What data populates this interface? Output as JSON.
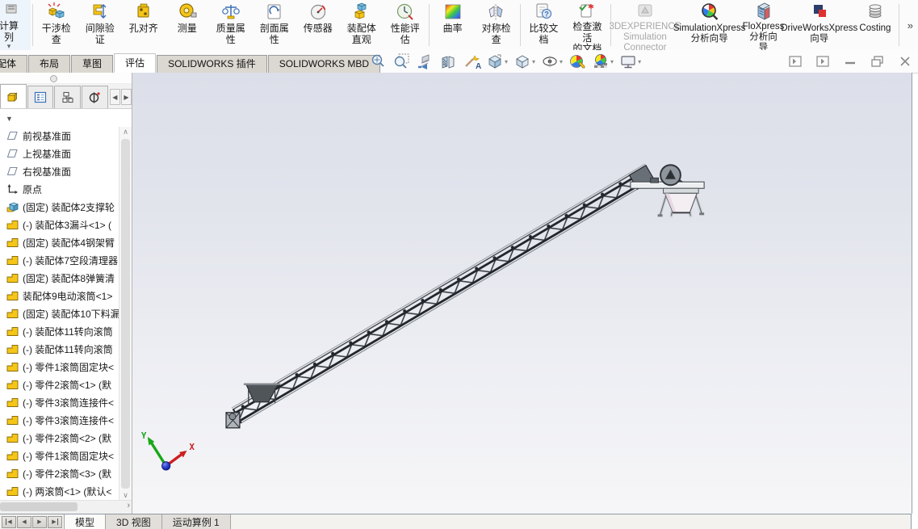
{
  "glyphs": {
    "caret": "▾",
    "overflow": "»",
    "panel_caret": "▼",
    "scroll_up": "∧",
    "scroll_down": "∨",
    "scroll_right": "›",
    "nav_prev": "◀",
    "nav_next": "▶",
    "ptab_left": "◀",
    "ptab_right": "▶"
  },
  "command_bar": {
    "items": [
      {
        "name": "calculate",
        "label": "计算\n列"
      },
      {
        "name": "interference-detection",
        "label": "干涉检\n查"
      },
      {
        "name": "clearance-verification",
        "label": "间隙验\n证"
      },
      {
        "name": "hole-alignment",
        "label": "孔对齐"
      },
      {
        "name": "measure",
        "label": "测量"
      },
      {
        "name": "mass-properties",
        "label": "质量属\n性"
      },
      {
        "name": "section-properties",
        "label": "剖面属\n性"
      },
      {
        "name": "sensor",
        "label": "传感器"
      },
      {
        "name": "assembly-visualization",
        "label": "装配体\n直观"
      },
      {
        "name": "performance-evaluation",
        "label": "性能评\n估"
      },
      {
        "name": "curvature",
        "label": "曲率"
      },
      {
        "name": "symmetry-check",
        "label": "对称检\n查"
      },
      {
        "name": "compare-documents",
        "label": "比较文\n档"
      },
      {
        "name": "check-active-document",
        "label": "检查激活\n的文档"
      },
      {
        "name": "3dexperience-simulation-connector",
        "label": "3DEXPERIENCE\nSimulation\nConnector"
      },
      {
        "name": "simulationxpress-wizard",
        "label": "SimulationXpress\n分析向导"
      },
      {
        "name": "floxpress-wizard",
        "label": "FloXpress\n分析向\n导"
      },
      {
        "name": "driveworksxpress-wizard",
        "label": "DriveWorksXpress\n向导"
      },
      {
        "name": "costing",
        "label": "Costing"
      }
    ]
  },
  "command_tabs": {
    "items": [
      {
        "label": "装配体"
      },
      {
        "label": "布局"
      },
      {
        "label": "草图"
      },
      {
        "label": "评估",
        "active": true
      },
      {
        "label": "SOLIDWORKS 插件"
      },
      {
        "label": "SOLIDWORKS MBD"
      }
    ]
  },
  "feature_tree": {
    "items": [
      {
        "type": "plane",
        "label": "前视基准面"
      },
      {
        "type": "plane",
        "label": "上视基准面"
      },
      {
        "type": "plane",
        "label": "右视基准面"
      },
      {
        "type": "origin",
        "label": "原点"
      },
      {
        "type": "part",
        "label": "(固定) 装配体2支撑轮"
      },
      {
        "type": "asm",
        "label": "(-) 装配体3漏斗<1> ("
      },
      {
        "type": "asm",
        "label": "(固定) 装配体4钢架臂"
      },
      {
        "type": "asm",
        "label": "(-) 装配体7空段清理器"
      },
      {
        "type": "asm",
        "label": "(固定) 装配体8弹簧清"
      },
      {
        "type": "asm",
        "label": "装配体9电动滚筒<1>"
      },
      {
        "type": "asm",
        "label": "(固定) 装配体10下料漏"
      },
      {
        "type": "asm",
        "label": "(-) 装配体11转向滚筒"
      },
      {
        "type": "asm",
        "label": "(-) 装配体11转向滚筒"
      },
      {
        "type": "asm",
        "label": "(-) 零件1滚筒固定块<"
      },
      {
        "type": "asm",
        "label": "(-) 零件2滚筒<1> (默"
      },
      {
        "type": "asm",
        "label": "(-) 零件3滚筒连接件<"
      },
      {
        "type": "asm",
        "label": "(-) 零件3滚筒连接件<"
      },
      {
        "type": "asm",
        "label": "(-) 零件2滚筒<2> (默"
      },
      {
        "type": "asm",
        "label": "(-) 零件1滚筒固定块<"
      },
      {
        "type": "asm",
        "label": "(-) 零件2滚筒<3> (默"
      },
      {
        "type": "asm",
        "label": "(-) 两滚筒<1> (默认<"
      }
    ]
  },
  "viewport": {
    "triad": {
      "x_label": "X",
      "y_label": "Y"
    }
  },
  "bottom_bar": {
    "tabs": [
      {
        "label": "模型",
        "active": true
      },
      {
        "label": "3D 视图"
      },
      {
        "label": "运动算例 1"
      }
    ]
  },
  "colors": {
    "viewport_gradient_top": "#dcdfe9",
    "viewport_gradient_bottom": "#f6f6f8",
    "inactive_tab": "#dbd8d1",
    "triad_x": "#cc2020",
    "triad_y": "#18a818",
    "triad_origin": "#2438c8",
    "assembly_icon": "#f5c518",
    "part_icon": "#74b9dd"
  }
}
